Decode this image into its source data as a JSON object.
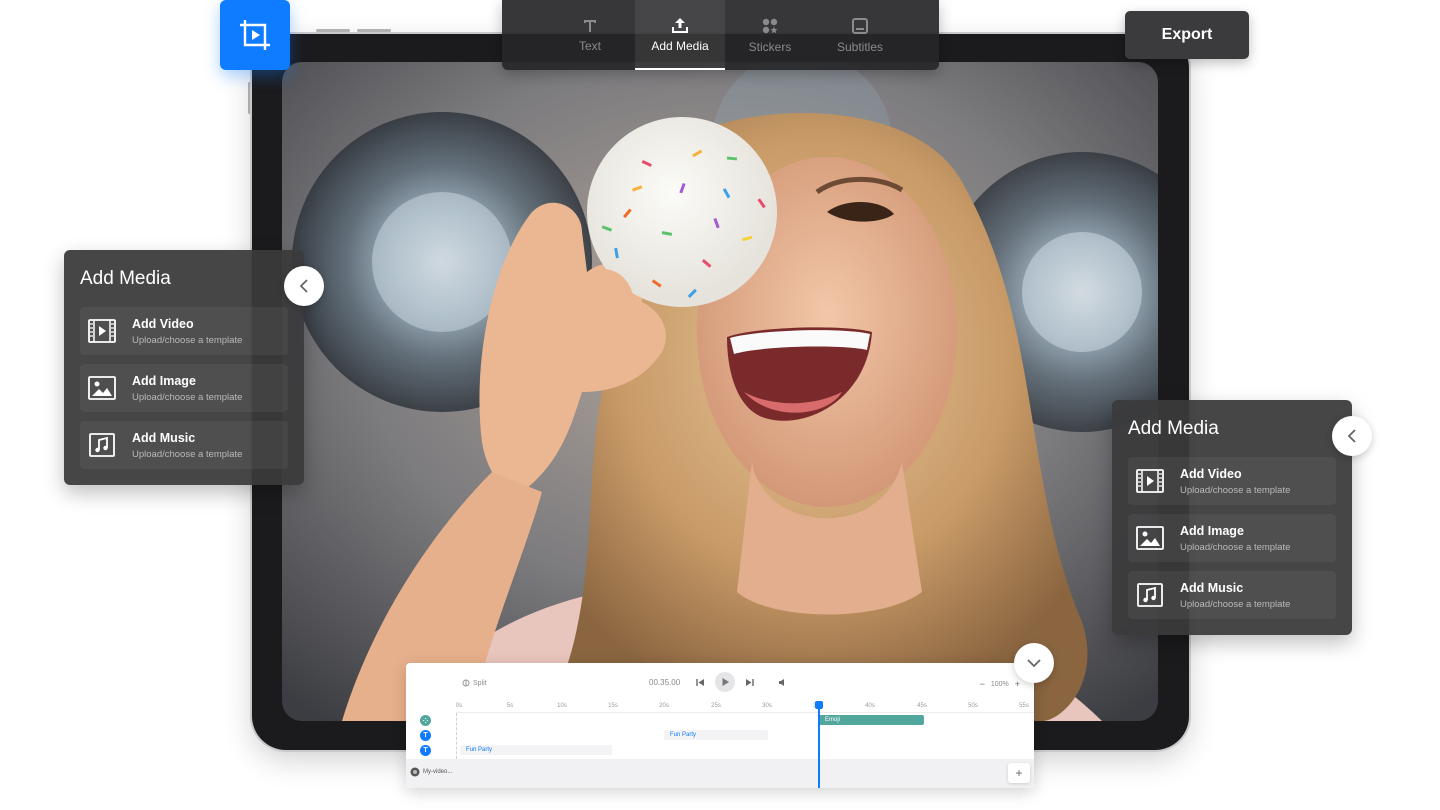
{
  "toolbar": {
    "tabs": [
      {
        "label": "Text",
        "icon": "text-icon"
      },
      {
        "label": "Add Media",
        "icon": "upload-icon"
      },
      {
        "label": "Stickers",
        "icon": "stickers-icon"
      },
      {
        "label": "Subtitles",
        "icon": "subtitles-icon"
      }
    ],
    "active_tab": "Add Media"
  },
  "export_label": "Export",
  "media_panel": {
    "title": "Add Media",
    "items": [
      {
        "label": "Add Video",
        "sub": "Upload/choose a template",
        "icon": "video-icon"
      },
      {
        "label": "Add Image",
        "sub": "Upload/choose a template",
        "icon": "image-icon"
      },
      {
        "label": "Add Music",
        "sub": "Upload/choose a template",
        "icon": "music-icon"
      }
    ]
  },
  "timeline": {
    "split_label": "Split",
    "timecode": "00.35.00",
    "zoom": "100%",
    "ruler": [
      "0s",
      "5s",
      "10s",
      "15s",
      "20s",
      "25s",
      "30s",
      "35s",
      "40s",
      "45s",
      "50s",
      "55s"
    ],
    "clips": {
      "emoji": "Emoji",
      "fun_party_1": "Fun Party",
      "fun_party_2": "Fun Party"
    },
    "track_name": "My-video..."
  },
  "colors": {
    "accent": "#0f7bff",
    "panel": "#3a3a3c",
    "emoji_clip": "#52a79c"
  }
}
